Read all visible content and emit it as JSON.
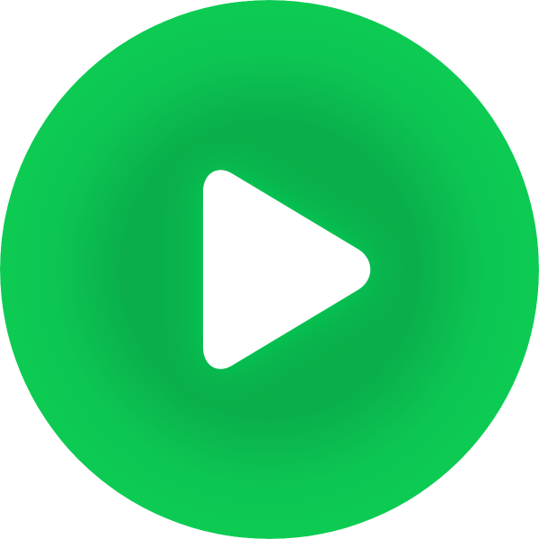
{
  "play_button": {
    "icon": "play-icon",
    "colors": {
      "outer": "#0CCB52",
      "inner": "#0AAF4B",
      "triangle": "#FFFFFF"
    }
  }
}
